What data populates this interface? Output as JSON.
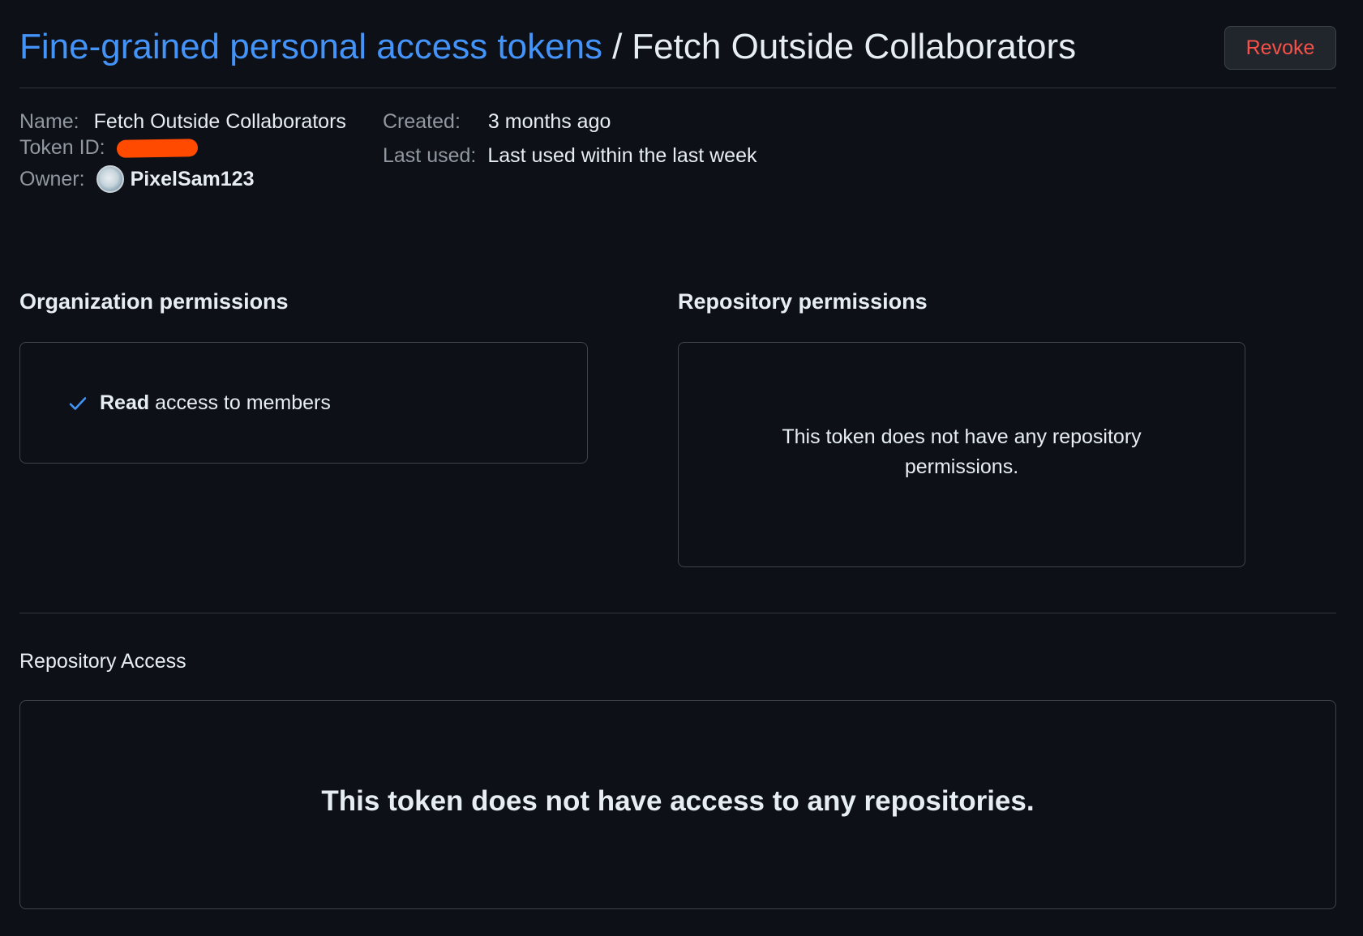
{
  "header": {
    "breadcrumb_link": "Fine-grained personal access tokens",
    "separator": "/",
    "current": "Fetch Outside Collaborators",
    "revoke_label": "Revoke"
  },
  "meta": {
    "name_label": "Name:",
    "name_value": "Fetch Outside Collaborators",
    "token_id_label": "Token ID:",
    "owner_label": "Owner:",
    "owner_value": "PixelSam123",
    "created_label": "Created:",
    "created_value": "3 months ago",
    "last_used_label": "Last used:",
    "last_used_value": "Last used within the last week"
  },
  "org_permissions": {
    "title": "Organization permissions",
    "items": [
      {
        "level": "Read",
        "text": "access to members",
        "icon": "check-icon"
      }
    ]
  },
  "repo_permissions": {
    "title": "Repository permissions",
    "empty_line1": "This token does not have any repository",
    "empty_line2": "permissions."
  },
  "repo_access": {
    "title": "Repository Access",
    "empty": "This token does not have access to any repositories."
  },
  "colors": {
    "background": "#0d1117",
    "link": "#4493f8",
    "danger": "#f85149",
    "redaction": "#ff4a00"
  }
}
